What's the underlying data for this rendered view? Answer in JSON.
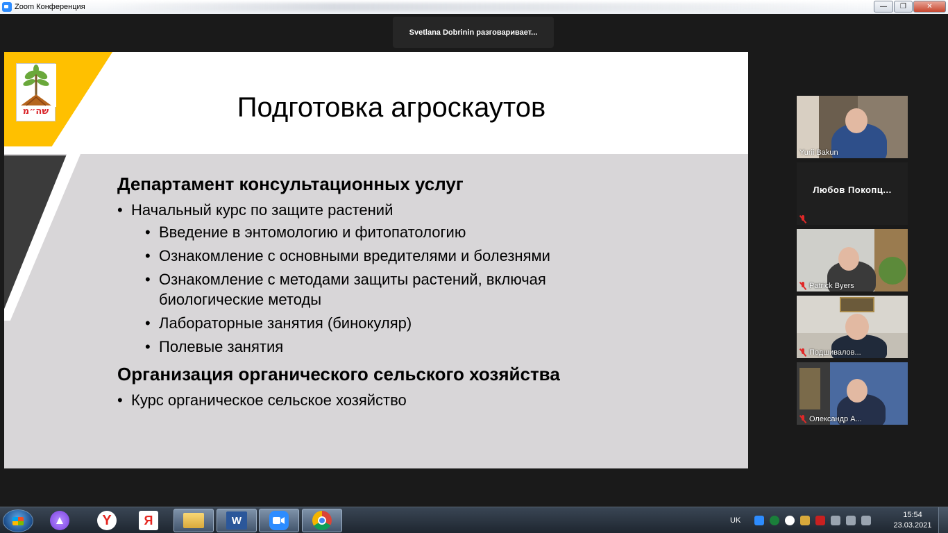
{
  "window": {
    "title": "Zoom Конференция",
    "minimize": "—",
    "maximize": "❐",
    "close": "✕"
  },
  "speaking_banner": "Svetlana Dobrinin разговаривает...",
  "slide": {
    "logo_text": "שה״מ",
    "title": "Подготовка агроскаутов",
    "section1": "Департамент консультационных услуг",
    "item1": "Начальный курс по защите растений",
    "sub_items": [
      "Введение в энтомологию и фитопатологию",
      "Ознакомление с основными вредителями и болезнями",
      "Ознакомление с методами защиты растений, включая биологические методы",
      "Лабораторные занятия (бинокуляр)",
      "Полевые занятия"
    ],
    "section2": "Организация органического сельского хозяйства",
    "item2": "Курс органическое сельское хозяйство"
  },
  "participants": [
    {
      "name": "Yurii Bakun",
      "muted": false
    },
    {
      "name": "Любов  Покопц...",
      "muted": true
    },
    {
      "name": "Patrick Byers",
      "muted": true
    },
    {
      "name": "Подшивалов...",
      "muted": true
    },
    {
      "name": "Олександр А...",
      "muted": true
    }
  ],
  "taskbar": {
    "pinned": [
      "alice-icon",
      "yandex-browser-icon",
      "yandex-icon",
      "file-explorer-icon",
      "word-icon",
      "zoom-icon",
      "chrome-icon"
    ],
    "word_label": "W",
    "yandex_label": "Я",
    "language": "UK",
    "time": "15:54",
    "date": "23.03.2021"
  },
  "colors": {
    "accent_yellow": "#ffc000",
    "zoom_blue": "#2d8cff",
    "mute_red": "#e02828"
  }
}
